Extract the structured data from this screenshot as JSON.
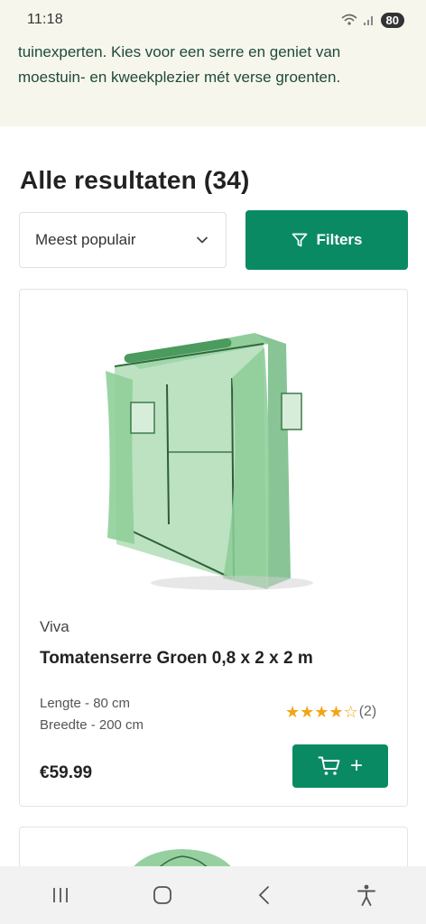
{
  "status_bar": {
    "time": "11:18",
    "battery": "80",
    "icons": [
      "wifi-icon",
      "signal-icon"
    ]
  },
  "intro": {
    "line1": "tuinexperten. Kies voor een serre en geniet van",
    "line2": "moestuin- en kweekplezier mét verse groenten."
  },
  "results": {
    "title": "Alle resultaten (34)"
  },
  "sort": {
    "selected": "Meest populair",
    "icon": "chevron-down-icon"
  },
  "filters": {
    "label": "Filters",
    "icon": "filter-icon"
  },
  "product": {
    "brand": "Viva",
    "title": "Tomatenserre Groen 0,8 x 2 x 2 m",
    "spec_length": "Lengte - 80 cm",
    "spec_width": "Breedte - 200 cm",
    "rating_value": 4.5,
    "rating_max": 5,
    "rating_count": "(2)",
    "price": "€59.99",
    "cart_plus": "+",
    "cart_icon": "shopping-cart-icon"
  },
  "nav_bar": {
    "icons": [
      "recent-apps-icon",
      "home-icon",
      "back-icon",
      "accessibility-icon"
    ]
  },
  "colors": {
    "brand_green": "#0a8a62",
    "banner_bg": "#f6f6ec",
    "star": "#f2a516",
    "intro_text": "#1f4a3a"
  }
}
